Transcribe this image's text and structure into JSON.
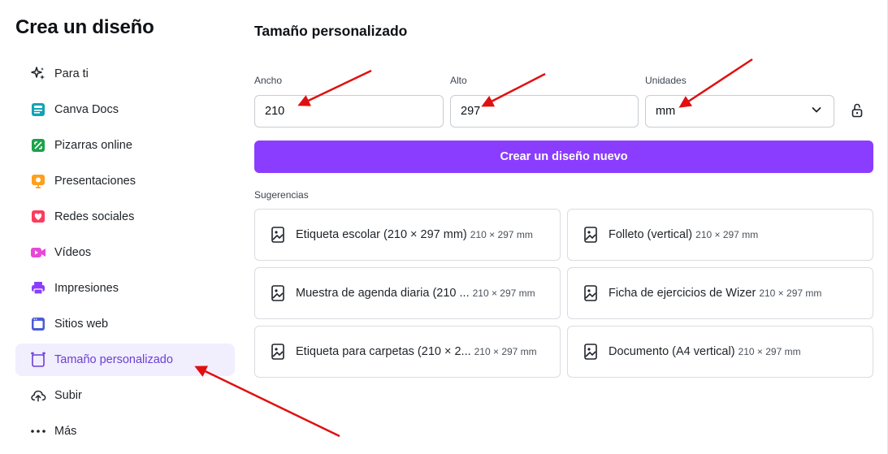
{
  "sidebar": {
    "title": "Crea un diseño",
    "items": [
      {
        "label": "Para ti",
        "icon": "sparkles-icon",
        "color": "#1e2329"
      },
      {
        "label": "Canva Docs",
        "icon": "docs-icon",
        "color": "#13a3b5"
      },
      {
        "label": "Pizarras online",
        "icon": "whiteboard-icon",
        "color": "#1aa34a"
      },
      {
        "label": "Presentaciones",
        "icon": "presentation-icon",
        "color": "#ff9f1c"
      },
      {
        "label": "Redes sociales",
        "icon": "heart-icon",
        "color": "#ff3b5c"
      },
      {
        "label": "Vídeos",
        "icon": "video-icon",
        "color": "#e649d6"
      },
      {
        "label": "Impresiones",
        "icon": "printer-icon",
        "color": "#8b3dff"
      },
      {
        "label": "Sitios web",
        "icon": "website-icon",
        "color": "#4c5bd8"
      },
      {
        "label": "Tamaño personalizado",
        "icon": "custom-size-icon",
        "color": "#6b3fd4"
      },
      {
        "label": "Subir",
        "icon": "cloud-upload-icon",
        "color": "#1e2329"
      },
      {
        "label": "Más",
        "icon": "more-dots-icon",
        "color": "#1e2329"
      }
    ],
    "active_index": 8
  },
  "main": {
    "title": "Tamaño personalizado",
    "width_label": "Ancho",
    "width_value": "210",
    "height_label": "Alto",
    "height_value": "297",
    "units_label": "Unidades",
    "units_value": "mm",
    "create_button": "Crear un diseño nuevo",
    "suggestions_label": "Sugerencias",
    "suggestions": [
      {
        "name": "Etiqueta escolar (210 × 297 mm)",
        "dims": "210 × 297 mm"
      },
      {
        "name": "Folleto (vertical)",
        "dims": "210 × 297 mm"
      },
      {
        "name": "Muestra de agenda diaria (210 ...",
        "dims": "210 × 297 mm"
      },
      {
        "name": "Ficha de ejercicios de Wizer",
        "dims": "210 × 297 mm"
      },
      {
        "name": "Etiqueta para carpetas (210 × 2...",
        "dims": "210 × 297 mm"
      },
      {
        "name": "Documento (A4 vertical)",
        "dims": "210 × 297 mm"
      }
    ]
  },
  "colors": {
    "accent": "#8b3dff",
    "active_bg": "#f1eefe",
    "annotation_arrow": "#e01010"
  }
}
